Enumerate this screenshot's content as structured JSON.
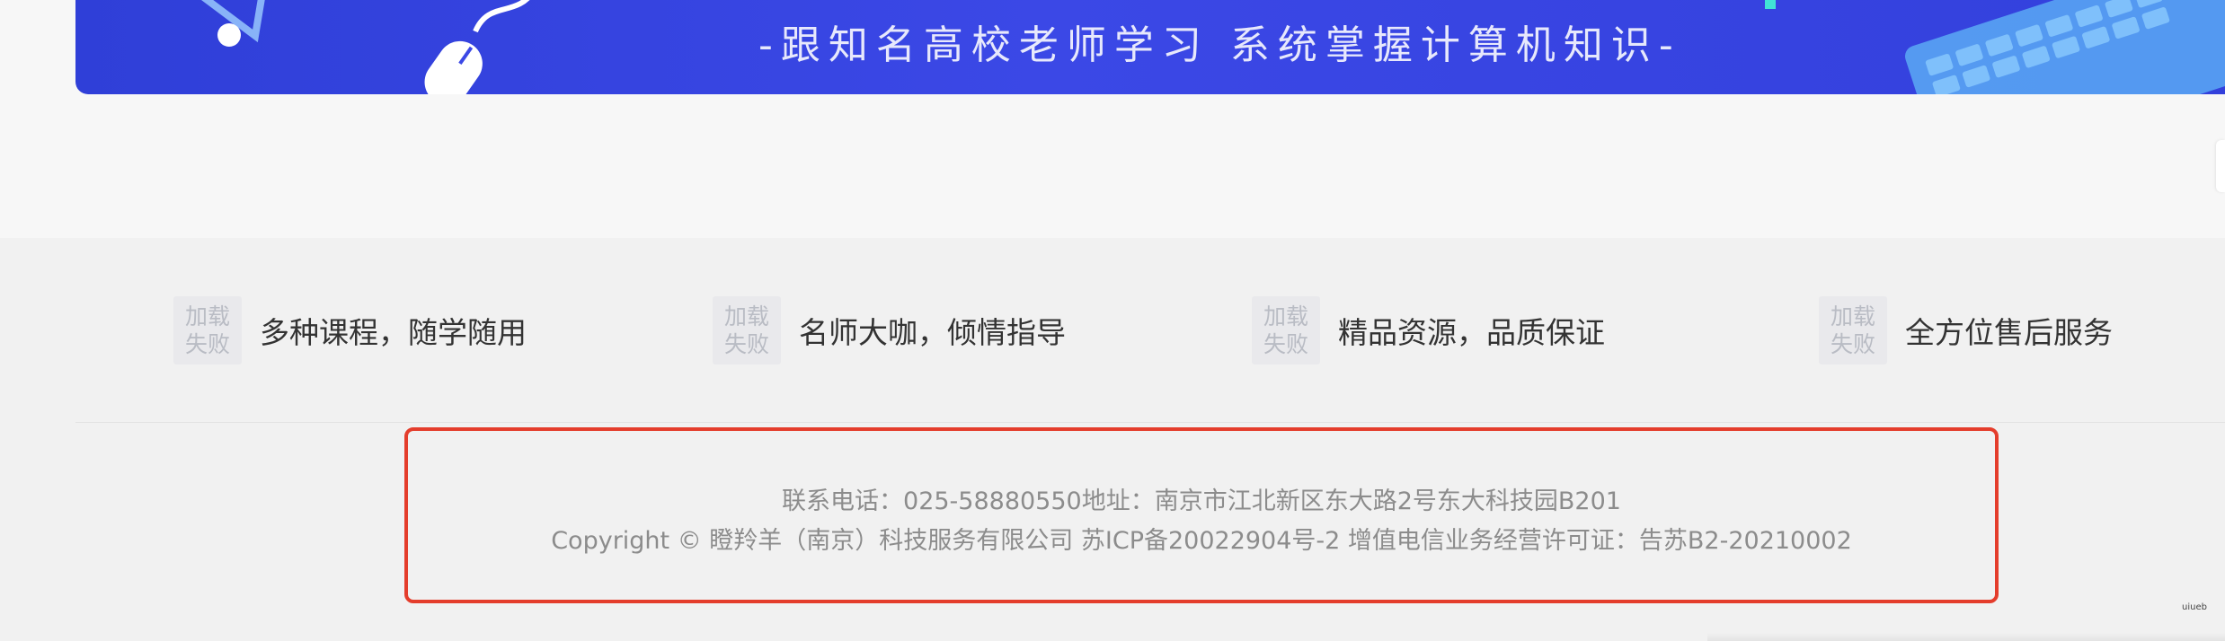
{
  "banner": {
    "slogan": "-跟知名高校老师学习 系统掌握计算机知识-",
    "colors": {
      "background": "#3340dc",
      "accent": "#41e2d6"
    }
  },
  "features": [
    {
      "image_alt": "加载\n失败",
      "text": "多种课程，随学随用"
    },
    {
      "image_alt": "加载\n失败",
      "text": "名师大咖，倾情指导"
    },
    {
      "image_alt": "加载\n失败",
      "text": "精品资源，品质保证"
    },
    {
      "image_alt": "加载\n失败",
      "text": "全方位售后服务"
    }
  ],
  "footer": {
    "contact_line": "联系电话：025-58880550地址：南京市江北新区东大路2号东大科技园B201",
    "copyright_line": "Copyright © 瞪羚羊（南京）科技服务有限公司 苏ICP备20022904号-2 增值电信业务经营许可证：告苏B2-20210002",
    "highlight_color": "#e43d2c"
  },
  "watermark": "uiueb"
}
